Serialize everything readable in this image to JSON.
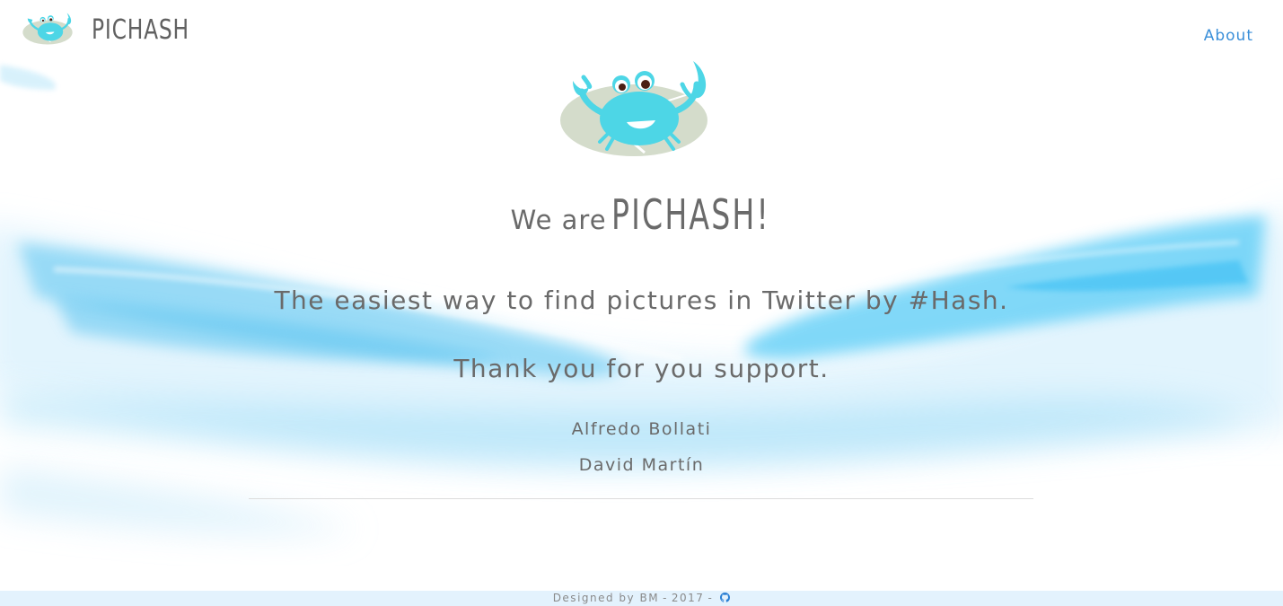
{
  "navbar": {
    "brand": "PICHASH",
    "logo_icon": "crab-logo-icon",
    "about_label": "About"
  },
  "hero": {
    "logo_icon": "crab-logo-icon",
    "headline_lead": "We are",
    "headline_brand": "PICHASH!",
    "tagline": "The easiest way to find pictures in Twitter by #Hash.",
    "thanks": "Thank you for you support.",
    "authors": [
      "Alfredo Bollati",
      "David Martín"
    ]
  },
  "footer": {
    "designed_by": "Designed by BM",
    "separator": "-",
    "year": "2017",
    "github_icon": "github-icon"
  },
  "colors": {
    "text": "#6a6a6a",
    "link": "#3a8fd9",
    "crab": "#4dd6e6",
    "leaf": "#d4dccb",
    "footer_bg": "#e3f2fd",
    "brush": "#5ccaf5"
  }
}
